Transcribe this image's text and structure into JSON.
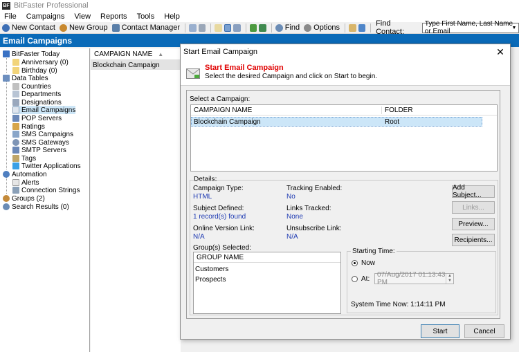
{
  "app": {
    "title": "BitFaster Professional",
    "logo": "BF"
  },
  "menu": [
    "File",
    "Campaigns",
    "View",
    "Reports",
    "Tools",
    "Help"
  ],
  "toolbar": {
    "new_contact": "New Contact",
    "new_group": "New Group",
    "contact_manager": "Contact Manager",
    "find": "Find",
    "options": "Options",
    "find_contact_label": "Find Contact:",
    "find_contact_value": "Type First Name, Last Name or Email"
  },
  "section_title": "Email Campaigns",
  "tree": {
    "bitfaster_today": "BitFaster Today",
    "anniversary": "Anniversary (0)",
    "birthday": "Birthday (0)",
    "data_tables": "Data Tables",
    "countries": "Countries",
    "departments": "Departments",
    "designations": "Designations",
    "email_campaigns": "Email Campaigns",
    "pop_servers": "POP Servers",
    "ratings": "Ratings",
    "sms_campaigns": "SMS Campaigns",
    "sms_gateways": "SMS Gateways",
    "smtp_servers": "SMTP Servers",
    "tags": "Tags",
    "twitter_apps": "Twitter Applications",
    "automation": "Automation",
    "alerts": "Alerts",
    "connection_strings": "Connection Strings",
    "groups": "Groups (2)",
    "search_results": "Search Results (0)"
  },
  "grid": {
    "column": "CAMPAIGN NAME",
    "sort_glyph": "▲",
    "row": "Blockchain Campaign"
  },
  "dialog": {
    "title": "Start Email Campaign",
    "close": "✕",
    "header_title": "Start Email Campaign",
    "header_subtitle": "Select the desired Campaign and click on Start to begin.",
    "select_label": "Select a Campaign:",
    "col_name": "CAMPAIGN NAME",
    "col_folder": "FOLDER",
    "campaign_name": "Blockchain Campaign",
    "campaign_folder": "Root",
    "details_label": "Details:",
    "campaign_type_label": "Campaign Type:",
    "campaign_type_value": "HTML",
    "tracking_label": "Tracking Enabled:",
    "tracking_value": "No",
    "subject_label": "Subject Defined:",
    "subject_value": "1 record(s) found",
    "links_label": "Links Tracked:",
    "links_value": "None",
    "online_label": "Online Version Link:",
    "online_value": "N/A",
    "unsub_label": "Unsubscribe Link:",
    "unsub_value": "N/A",
    "btn_add_subject": "Add Subject...",
    "btn_links": "Links...",
    "btn_preview": "Preview...",
    "btn_recipients": "Recipients...",
    "groups_label": "Group(s) Selected:",
    "groups_col": "GROUP NAME",
    "group_1": "Customers",
    "group_2": "Prospects",
    "starting_time_label": "Starting Time:",
    "now_label": "Now",
    "at_label": "At:",
    "at_value": "07/Aug/2017 01:13:43 PM",
    "system_time": "System Time Now:   1:14:11 PM",
    "btn_start": "Start",
    "btn_cancel": "Cancel"
  }
}
